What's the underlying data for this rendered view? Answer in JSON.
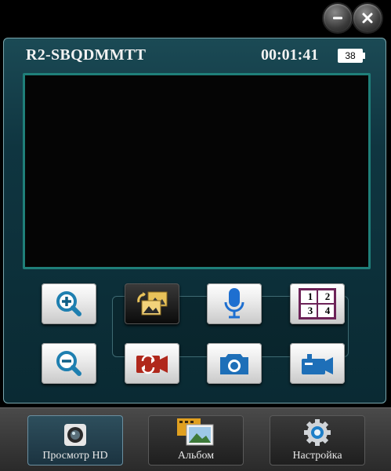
{
  "header": {
    "device_name": "R2-SBQDMMTT",
    "timer": "00:01:41",
    "battery": "38"
  },
  "window_controls": {
    "minimize_icon": "minus-circle-icon",
    "close_icon": "close-circle-icon"
  },
  "controls": {
    "row1": [
      "zoom-in-icon",
      "switch-gallery-icon",
      "microphone-icon",
      "grid-view-icon"
    ],
    "row2": [
      "zoom-out-icon",
      "flip-camera-icon",
      "camera-icon",
      "video-camera-icon"
    ],
    "grid_labels": [
      "1",
      "2",
      "3",
      "4"
    ]
  },
  "tabs": [
    {
      "label": "Просмотр HD",
      "icon": "camera-lens-icon"
    },
    {
      "label": "Альбом",
      "icon": "album-icon"
    },
    {
      "label": "Настройка",
      "icon": "settings-gear-icon"
    }
  ],
  "colors": {
    "accent": "#1e90c8",
    "panel_border": "#7aa6ad",
    "video_border": "#1f7f79",
    "red_icon": "#b0281c",
    "grid_purple": "#6d2358"
  }
}
